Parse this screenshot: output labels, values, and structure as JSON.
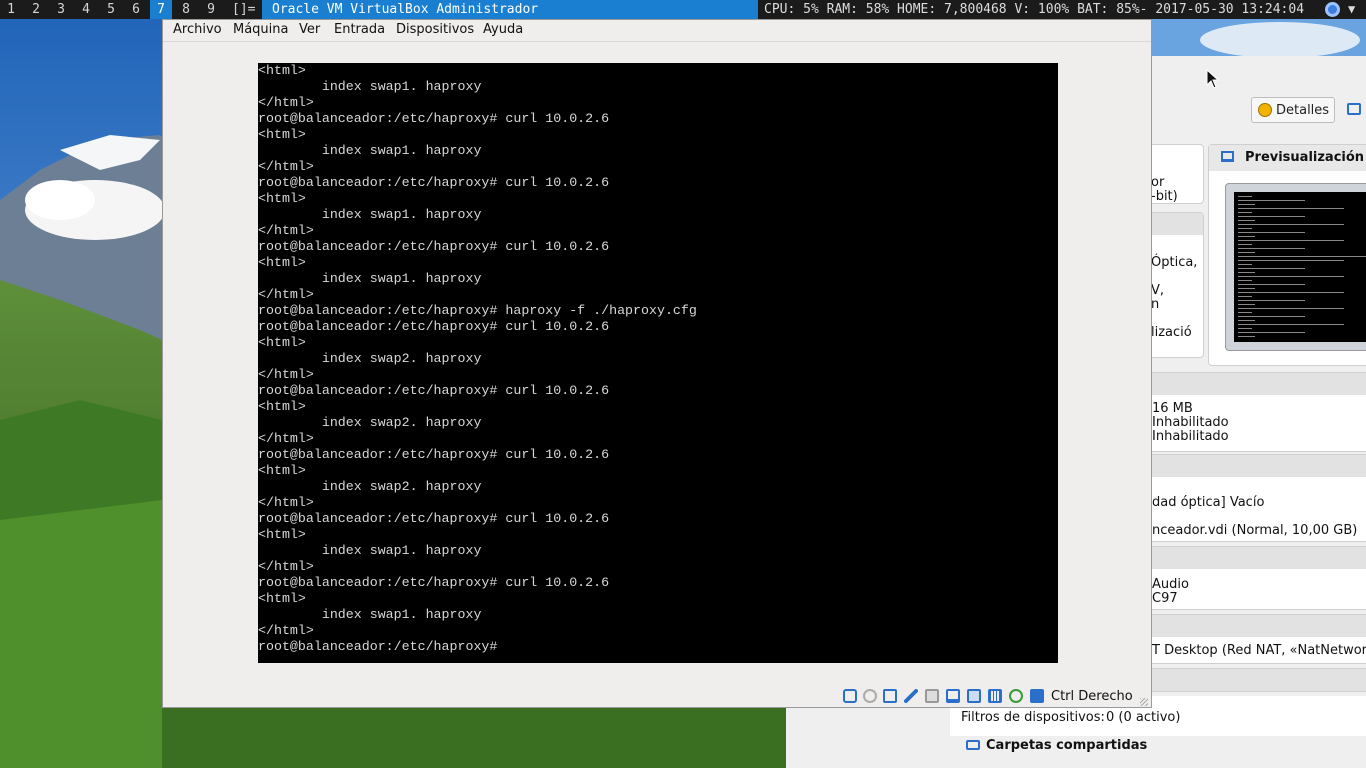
{
  "topbar": {
    "workspaces": [
      {
        "label": "1",
        "active": false
      },
      {
        "label": "2",
        "active": false
      },
      {
        "label": "3",
        "active": false
      },
      {
        "label": "4",
        "active": false
      },
      {
        "label": "5",
        "active": false
      },
      {
        "label": "6",
        "active": false
      },
      {
        "label": "7",
        "active": true
      },
      {
        "label": "8",
        "active": false
      },
      {
        "label": "9",
        "active": false
      }
    ],
    "layout_symbol": "[]=",
    "window_title": "Oracle VM VirtualBox Administrador",
    "status": "CPU: 5% RAM: 58% HOME: 7,800468 V: 100% BAT: 85%- 2017-05-30 13:24:04",
    "tray_icons": [
      "chromium-icon",
      "dropdown-arrow-icon"
    ],
    "colors": {
      "bar_bg": "#1b1b1b",
      "accent": "#1a7fd0"
    }
  },
  "vm_window": {
    "menu": {
      "archivo": "Archivo",
      "maquina": "Máquina",
      "ver": "Ver",
      "entrada": "Entrada",
      "dispositivos": "Dispositivos",
      "ayuda": "Ayuda"
    },
    "console_lines": [
      "<html>",
      "        index swap1. haproxy",
      "</html>",
      "root@balanceador:/etc/haproxy# curl 10.0.2.6",
      "<html>",
      "        index swap1. haproxy",
      "</html>",
      "root@balanceador:/etc/haproxy# curl 10.0.2.6",
      "<html>",
      "        index swap1. haproxy",
      "</html>",
      "root@balanceador:/etc/haproxy# curl 10.0.2.6",
      "<html>",
      "        index swap1. haproxy",
      "</html>",
      "root@balanceador:/etc/haproxy# haproxy -f ./haproxy.cfg",
      "root@balanceador:/etc/haproxy# curl 10.0.2.6",
      "<html>",
      "        index swap2. haproxy",
      "</html>",
      "root@balanceador:/etc/haproxy# curl 10.0.2.6",
      "<html>",
      "        index swap2. haproxy",
      "</html>",
      "root@balanceador:/etc/haproxy# curl 10.0.2.6",
      "<html>",
      "        index swap2. haproxy",
      "</html>",
      "root@balanceador:/etc/haproxy# curl 10.0.2.6",
      "<html>",
      "        index swap1. haproxy",
      "</html>",
      "root@balanceador:/etc/haproxy# curl 10.0.2.6",
      "<html>",
      "        index swap1. haproxy",
      "</html>",
      "root@balanceador:/etc/haproxy#"
    ],
    "statusbar_icons": [
      "hard-disk-icon",
      "optical-drive-icon",
      "network-icon",
      "usb-icon",
      "shared-folder-icon",
      "display-icon",
      "video-capture-icon",
      "cpu-icon",
      "mouse-integration-icon",
      "keyboard-icon"
    ],
    "host_key": "Ctrl Derecho"
  },
  "manager": {
    "details_button": "Detalles",
    "preview_title": "Previsualización",
    "general_fragments": [
      "or",
      "-bit)"
    ],
    "system_fragments": [
      "Óptica,",
      "V,",
      "n",
      "lizació"
    ],
    "display_fragments": [
      "16 MB",
      "Inhabilitado",
      "Inhabilitado"
    ],
    "storage_fragments": [
      "dad óptica] Vacío",
      "nceador.vdi (Normal, 10,00 GB)"
    ],
    "audio_fragments": [
      "Audio",
      "C97"
    ],
    "network_fragment": "T Desktop (Red NAT, «NatNetwork»)",
    "usb_filters_label": "Filtros de dispositivos:",
    "usb_filters_value": "0 (0 activo)",
    "shared_folders_title": "Carpetas compartidas"
  }
}
